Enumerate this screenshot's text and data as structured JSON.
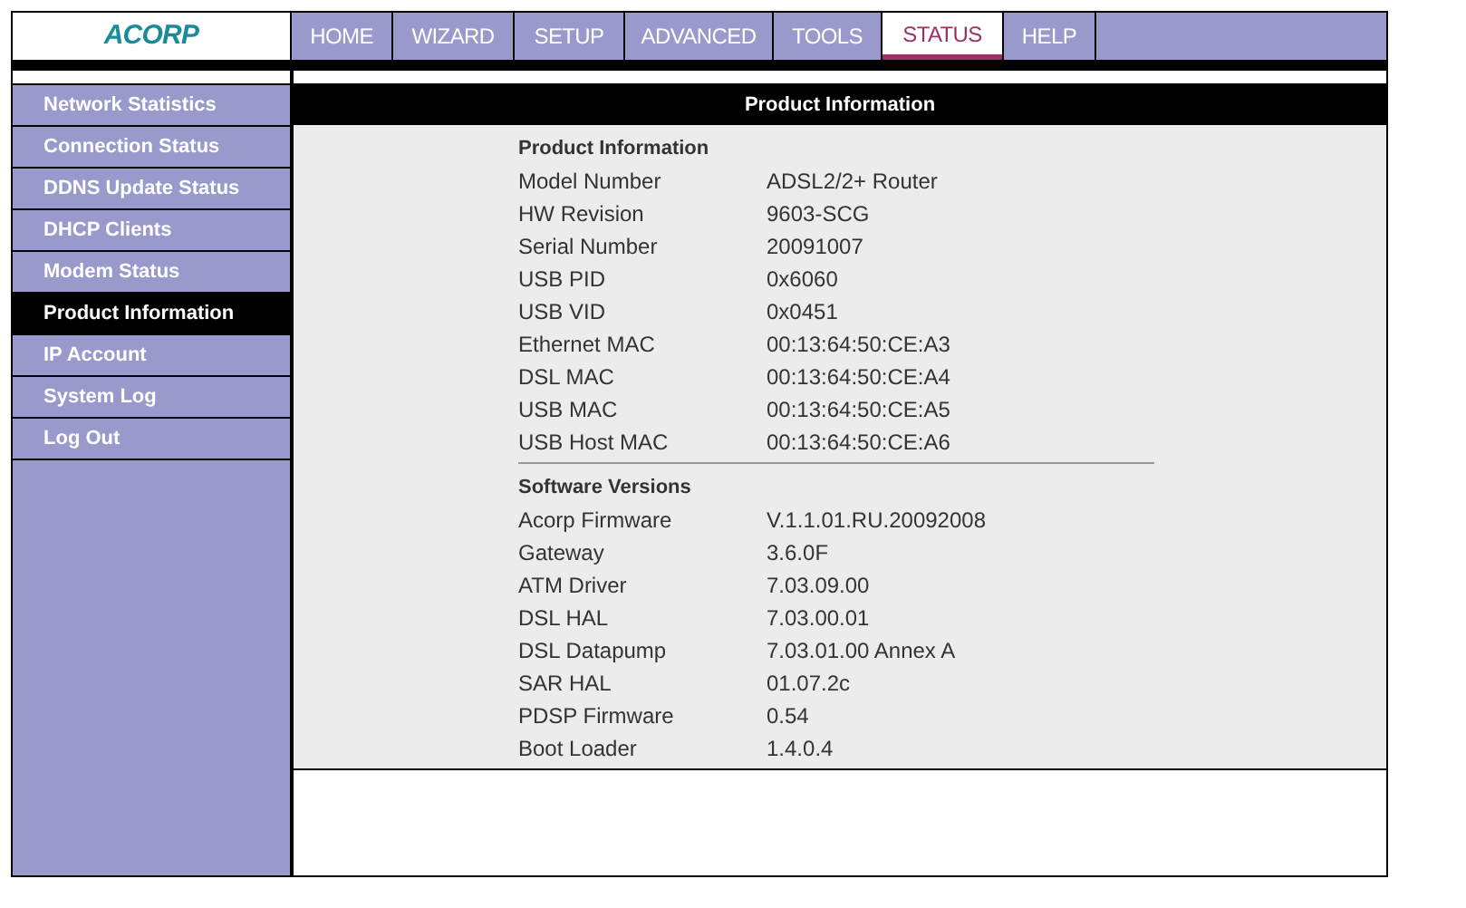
{
  "logo": {
    "text": "ACORP"
  },
  "tabs": [
    {
      "label": "HOME",
      "selected": false
    },
    {
      "label": "WIZARD",
      "selected": false
    },
    {
      "label": "SETUP",
      "selected": false
    },
    {
      "label": "ADVANCED",
      "selected": false
    },
    {
      "label": "TOOLS",
      "selected": false
    },
    {
      "label": "STATUS",
      "selected": true
    },
    {
      "label": "HELP",
      "selected": false
    }
  ],
  "sidebar": {
    "items": [
      {
        "label": "Network Statistics",
        "selected": false
      },
      {
        "label": "Connection Status",
        "selected": false
      },
      {
        "label": "DDNS Update Status",
        "selected": false
      },
      {
        "label": "DHCP Clients",
        "selected": false
      },
      {
        "label": "Modem Status",
        "selected": false
      },
      {
        "label": "Product Information",
        "selected": true
      },
      {
        "label": "IP Account",
        "selected": false
      },
      {
        "label": "System Log",
        "selected": false
      },
      {
        "label": "Log Out",
        "selected": false
      }
    ]
  },
  "panel": {
    "title": "Product Information",
    "sections": [
      {
        "title": "Product Information",
        "rows": [
          {
            "label": "Model Number",
            "value": "ADSL2/2+ Router"
          },
          {
            "label": "HW Revision",
            "value": "9603-SCG"
          },
          {
            "label": "Serial Number",
            "value": "20091007"
          },
          {
            "label": "USB PID",
            "value": "0x6060"
          },
          {
            "label": "USB VID",
            "value": "0x0451"
          },
          {
            "label": "Ethernet MAC",
            "value": "00:13:64:50:CE:A3"
          },
          {
            "label": "DSL MAC",
            "value": "00:13:64:50:CE:A4"
          },
          {
            "label": "USB MAC",
            "value": "00:13:64:50:CE:A5"
          },
          {
            "label": "USB Host MAC",
            "value": "00:13:64:50:CE:A6"
          }
        ]
      },
      {
        "title": "Software Versions",
        "rows": [
          {
            "label": "Acorp Firmware",
            "value": "V.1.1.01.RU.20092008"
          },
          {
            "label": "Gateway",
            "value": "3.6.0F"
          },
          {
            "label": "ATM Driver",
            "value": "7.03.09.00"
          },
          {
            "label": "DSL HAL",
            "value": "7.03.00.01"
          },
          {
            "label": "DSL Datapump",
            "value": "7.03.01.00 Annex A"
          },
          {
            "label": "SAR HAL",
            "value": "01.07.2c"
          },
          {
            "label": "PDSP Firmware",
            "value": "0.54"
          },
          {
            "label": "Boot Loader",
            "value": "1.4.0.4"
          }
        ]
      }
    ]
  }
}
